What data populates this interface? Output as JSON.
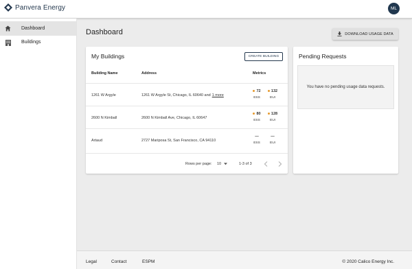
{
  "app": {
    "brand": "Panvera Energy",
    "user_initials": "ML"
  },
  "sidebar": {
    "items": [
      {
        "label": "Dashboard",
        "icon": "home-icon"
      },
      {
        "label": "Buildings",
        "icon": "building-icon"
      }
    ]
  },
  "page": {
    "title": "Dashboard",
    "download_label": "DOWNLOAD USAGE DATA"
  },
  "buildings_card": {
    "title": "My Buildings",
    "create_label": "CREATE BUILDING",
    "columns": {
      "name": "Building Name",
      "address": "Address",
      "metrics": "Metrics"
    },
    "rows": [
      {
        "name": "1261 W Argyle",
        "address": "1261 W Argyle St, Chicago, IL 60640 and",
        "more": "1 more",
        "ess": "72",
        "eui": "132",
        "ess_label": "ESS",
        "eui_label": "EUI"
      },
      {
        "name": "2600 N Kimball",
        "address": "2600 N Kimball Ave, Chicago, IL 60647",
        "more": "",
        "ess": "80",
        "eui": "128",
        "ess_label": "ESS",
        "eui_label": "EUI"
      },
      {
        "name": "Artaud",
        "address": "2727 Mariposa St, San Francisco, CA 94110",
        "more": "",
        "ess": "—",
        "eui": "—",
        "ess_label": "ESS",
        "eui_label": "EUI"
      }
    ],
    "pagination": {
      "rows_per_page_label": "Rows per page:",
      "rows_per_page": "10",
      "range": "1-3 of 3"
    }
  },
  "pending_card": {
    "title": "Pending Requests",
    "empty_message": "You have no pending usage data requests."
  },
  "footer": {
    "links": [
      "Legal",
      "Contact",
      "ESPM"
    ],
    "copyright": "© 2020 Calico Energy Inc."
  },
  "colors": {
    "brand": "#23374d",
    "metric_dot": "#e69a2e",
    "background": "#ececec"
  }
}
